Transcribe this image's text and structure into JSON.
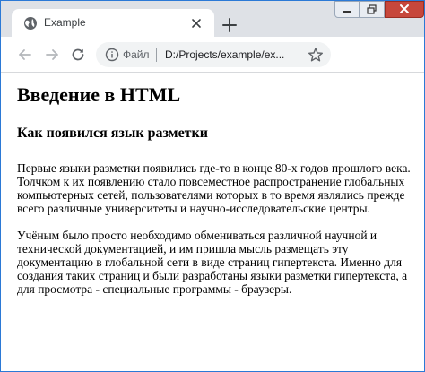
{
  "browser": {
    "tab": {
      "title": "Example"
    },
    "new_tab_symbol": "+",
    "address_bar": {
      "scheme_label": "Файл",
      "url": "D:/Projects/example/ex..."
    }
  },
  "page": {
    "heading": "Введение в HTML",
    "subheading": "Как появился язык разметки",
    "paragraphs": [
      "Первые языки разметки появились где-то в конце 80-х годов прошлого века. Толчком к их появлению стало повсеместное распространение глобальных компьютерных сетей, пользователями которых в то время являлись прежде всего различные университеты и научно-исследовательские центры.",
      "Учёным было просто необходимо обмениваться различной научной и технической документацией, и им пришла мысль размещать эту документацию в глобальной сети в виде страниц гипертекста. Именно для создания таких страниц и были разработаны языки разметки гипертекста, а для просмотра - специальные программы - браузеры."
    ]
  },
  "icons": {
    "favicon": "globe-icon",
    "tab_close": "close-icon",
    "back": "arrow-left-icon",
    "forward": "arrow-right-icon",
    "reload": "reload-icon",
    "info": "info-icon",
    "bookmark": "star-icon"
  },
  "colors": {
    "titlebar": "#dee1e6",
    "window_border": "#2b79d6",
    "omnibox": "#f1f3f4",
    "close_button": "#c7473b"
  }
}
